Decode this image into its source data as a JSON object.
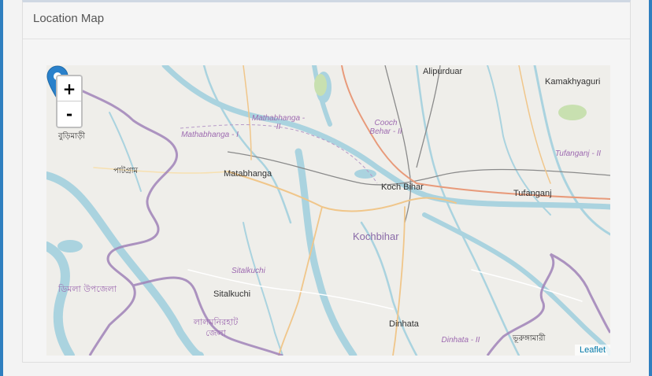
{
  "panel": {
    "title": "Location Map"
  },
  "map": {
    "zoom_in_label": "+",
    "zoom_out_label": "-",
    "attribution": "Leaflet",
    "labels": {
      "alipurduar": "Alipurduar",
      "kamakhyaguri": "Kamakhyaguri",
      "cooch_behar_ii": "Cooch Behar - II",
      "mathabhanga_ii": "Mathabhanga - II",
      "mathabhanga_i": "Mathabhanga - I",
      "buri": "বুড়িমাড়ী",
      "patgram": "পাটগ্রাম",
      "matabhanga": "Matabhanga",
      "koch_bihar": "Koch Bihar",
      "tufanganj": "Tufanganj",
      "tufanganj_ii": "Tufanganj - II",
      "kochbihar": "Kochbihar",
      "sitalkuchi_admin": "Sitalkuchi",
      "sitalkuchi": "Sitalkuchi",
      "dimla": "ডিমলা উপজেলা",
      "lalmonirhat": "লালমনিরহাট জেলা",
      "dinhata": "Dinhata",
      "dinhata_ii": "Dinhata - II",
      "bhurungamari": "ভূরুঙ্গামারী"
    },
    "marker_icon": "map-pin-icon",
    "colors": {
      "water": "#aad3df",
      "border": "#a083b8",
      "road_primary": "#f0c68a",
      "road_trunk": "#e89a7a",
      "rail": "#888888",
      "marker": "#2a81cb"
    }
  }
}
